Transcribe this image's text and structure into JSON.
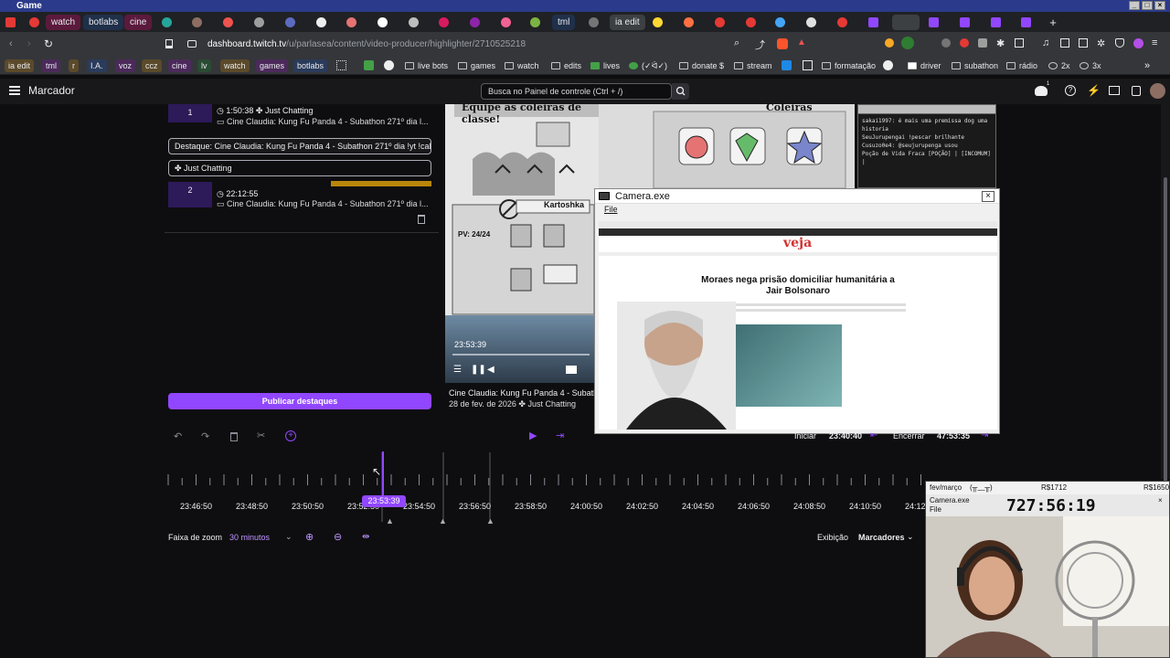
{
  "os": {
    "title": "Game"
  },
  "tabs": {
    "named": [
      "watch",
      "botlabs",
      "cine",
      "tml",
      "ia edit"
    ]
  },
  "address": {
    "host": "dashboard.twitch.tv",
    "path": "/u/parlasea/content/video-producer/highlighter/2710525218"
  },
  "bookmarks": [
    "ia edit",
    "tml",
    "r",
    "I.A.",
    "voz",
    "ccz",
    "cine",
    "lv",
    "watch",
    "games",
    "botlabs",
    "live bots",
    "games",
    "watch",
    "edits",
    "lives",
    "(✓ᐛ✓)",
    "donate $",
    "stream",
    "formatação",
    "driver",
    "subathon",
    "rádio",
    "2x",
    "3x"
  ],
  "header": {
    "menu_label": "Marcador",
    "search_placeholder": "Busca no Painel de controle (Ctrl + /)"
  },
  "highlights": [
    {
      "num": "1",
      "time": "1:50:38",
      "category": "Just Chatting",
      "title": "Cine Claudia: Kung Fu Panda 4 - Subathon 271º dia l..."
    },
    {
      "num": "2",
      "time": "22:12:55",
      "title": "Cine Claudia: Kung Fu Panda 4 - Subathon 271º dia l..."
    }
  ],
  "editor": {
    "title_field": "Destaque: Cine Claudia: Kung Fu Panda 4 - Subathon 271º dia !yt !cal",
    "category_field": "Just Chatting",
    "publish_label": "Publicar destaques"
  },
  "video": {
    "game_banner": "Equipe as coleiras de classe!",
    "coleiras": "Coleiras",
    "kartoshka": "Kartoshka",
    "pv": "PV: 24/24",
    "timestamp": "23:53:39",
    "meta_title": "Cine Claudia: Kung Fu Panda 4 - Subath",
    "meta_date": "28 de fev. de 2026",
    "meta_category": "Just Chatting"
  },
  "chat": {
    "lines": [
      "sakai1997: é mais uma premissa dog uma",
      "historia",
      "SeuJurupengai !pescar brilhante",
      "Cusuzo0e4: @seujurupenga usou",
      "Poção de Vida Fraca [POÇÃO] | [INCOMUM] |"
    ]
  },
  "camera_window": {
    "title": "Camera.exe",
    "menu": "File",
    "article_brand": "veja",
    "article_headline_1": "Moraes nega prisão domiciliar humanitária a",
    "article_headline_2": "Jair Bolsonaro"
  },
  "timeline": {
    "iniciar_label": "Iniciar",
    "iniciar_time": "23:40:40",
    "encerrar_label": "Encerrar",
    "encerrar_time": "47:53:35",
    "ticks": [
      "23:46:50",
      "23:48:50",
      "23:50:50",
      "23:52:50",
      "23:54:50",
      "23:56:50",
      "23:58:50",
      "24:00:50",
      "24:02:50",
      "24:04:50",
      "24:06:50",
      "24:08:50",
      "24:10:50",
      "24:12"
    ],
    "playhead": "23:53:39",
    "zoom_label": "Faixa de zoom",
    "zoom_value": "30 minutos",
    "exhibit_label": "Exibição",
    "exhibit_value": "Marcadores"
  },
  "webcam": {
    "header_left": "fev/março",
    "header_emote": "(╥﹏╥)",
    "header_mid": "R$1712",
    "header_right": "R$1650",
    "window_title": "Camera.exe",
    "window_menu": "File",
    "counter": "727:56:19"
  },
  "colors": {
    "accent": "#9147ff",
    "background": "#0e0e10",
    "highlight_number_bg": "#2c1a59",
    "playhead": "#9147ff"
  }
}
